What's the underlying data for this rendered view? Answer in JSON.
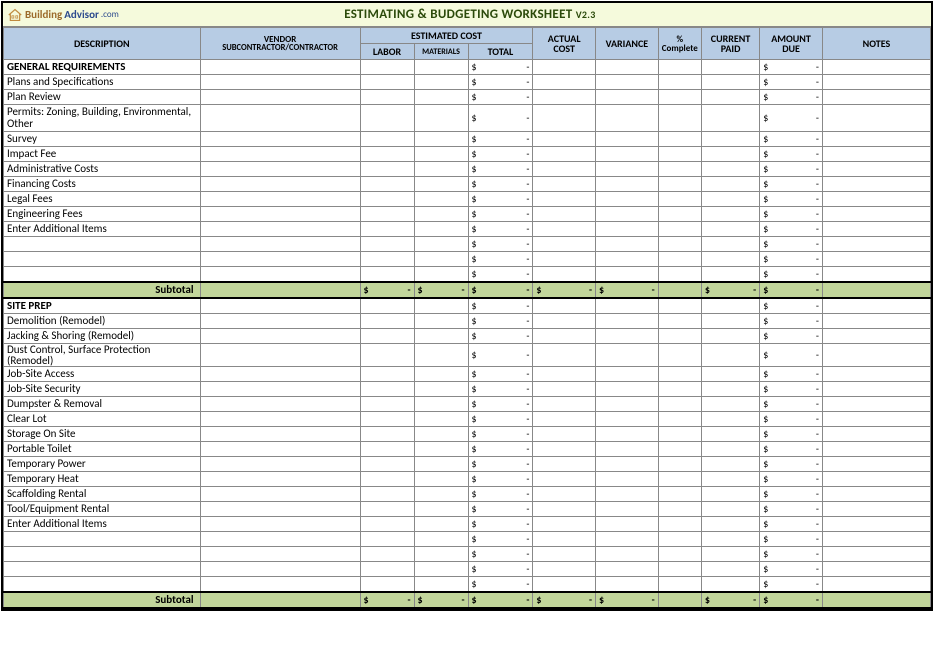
{
  "brand": {
    "building": "Building",
    "advisor": "Advisor",
    "dotcom": ".com"
  },
  "title": "ESTIMATING & BUDGETING WORKSHEET",
  "version": "V2.3",
  "headers": {
    "description": "DESCRIPTION",
    "vendor_top": "VENDOR",
    "vendor_sub": "SUBCONTRACTOR/CONTRACTOR",
    "estimated": "ESTIMATED COST",
    "labor": "LABOR",
    "materials": "MATERIALS",
    "total": "TOTAL",
    "actual": "ACTUAL COST",
    "variance": "VARIANCE",
    "complete": "% Complete",
    "paid": "CURRENT PAID",
    "due": "AMOUNT DUE",
    "notes": "NOTES"
  },
  "sections": [
    {
      "name": "GENERAL REQUIREMENTS",
      "rows": [
        {
          "desc": "Plans and Specifications"
        },
        {
          "desc": "Plan Review"
        },
        {
          "desc": "Permits: Zoning, Building, Environmental, Other",
          "wrap": true
        },
        {
          "desc": "Survey"
        },
        {
          "desc": "Impact Fee"
        },
        {
          "desc": "Administrative Costs"
        },
        {
          "desc": "Financing Costs"
        },
        {
          "desc": "Legal Fees"
        },
        {
          "desc": "Engineering Fees"
        },
        {
          "desc": "Enter Additional Items"
        },
        {
          "desc": ""
        },
        {
          "desc": ""
        },
        {
          "desc": ""
        }
      ],
      "subtotal": {
        "label": "Subtotal",
        "labor": {
          "sym": "$",
          "val": "-"
        },
        "materials": {
          "sym": "$",
          "val": "-"
        },
        "total": {
          "sym": "$",
          "val": "-"
        },
        "actual": {
          "sym": "$",
          "val": "-"
        },
        "variance": {
          "sym": "$",
          "val": "-"
        },
        "paid": {
          "sym": "$",
          "val": "-"
        },
        "due": {
          "sym": "$",
          "val": "-"
        }
      }
    },
    {
      "name": "SITE PREP",
      "rows": [
        {
          "desc": "Demolition (Remodel)"
        },
        {
          "desc": "Jacking & Shoring (Remodel)"
        },
        {
          "desc": "Dust Control, Surface Protection (Remodel)",
          "clip": true
        },
        {
          "desc": "Job-Site Access"
        },
        {
          "desc": "Job-Site Security"
        },
        {
          "desc": "Dumpster & Removal"
        },
        {
          "desc": "Clear Lot"
        },
        {
          "desc": "Storage On Site"
        },
        {
          "desc": "Portable Toilet"
        },
        {
          "desc": "Temporary Power"
        },
        {
          "desc": "Temporary Heat"
        },
        {
          "desc": "Scaffolding Rental"
        },
        {
          "desc": "Tool/Equipment Rental"
        },
        {
          "desc": "Enter Additional Items"
        },
        {
          "desc": ""
        },
        {
          "desc": ""
        },
        {
          "desc": ""
        },
        {
          "desc": ""
        }
      ],
      "subtotal": {
        "label": "Subtotal",
        "labor": {
          "sym": "$",
          "val": "-"
        },
        "materials": {
          "sym": "$",
          "val": "-"
        },
        "total": {
          "sym": "$",
          "val": "-"
        },
        "actual": {
          "sym": "$",
          "val": "-"
        },
        "variance": {
          "sym": "$",
          "val": "-"
        },
        "paid": {
          "sym": "$",
          "val": "-"
        },
        "due": {
          "sym": "$",
          "val": "-"
        }
      }
    }
  ],
  "money_default": {
    "sym": "$",
    "val": "-"
  }
}
